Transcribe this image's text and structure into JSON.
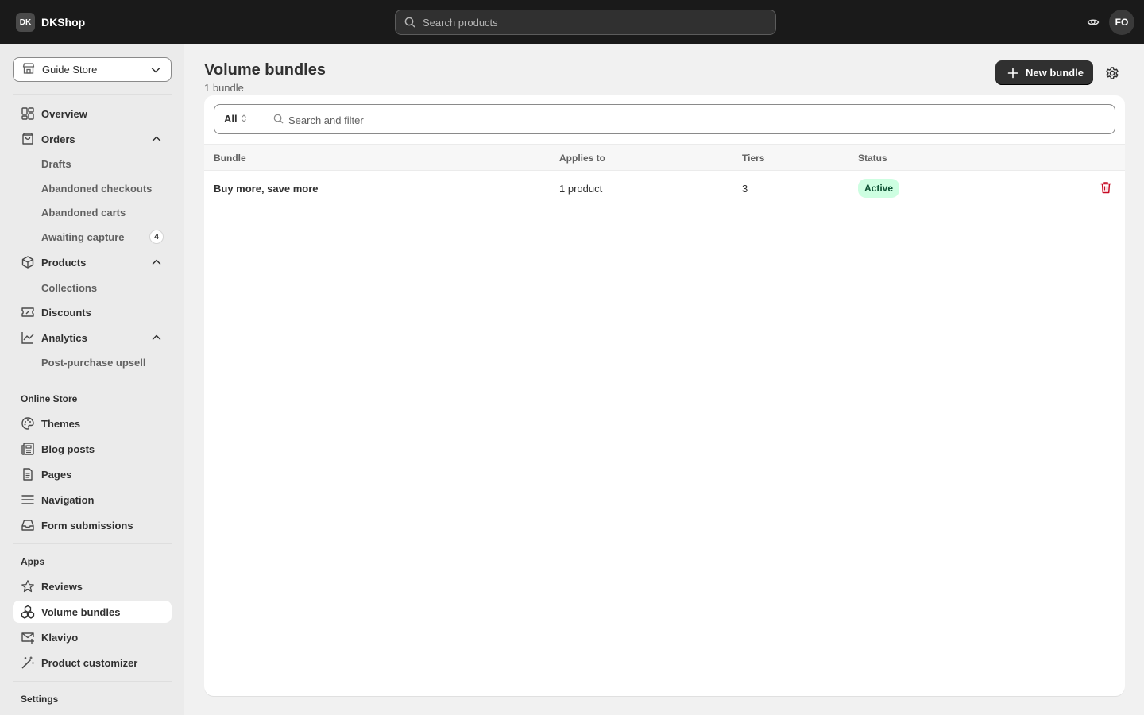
{
  "topbar": {
    "brand_logo": "DK",
    "brand_name": "DKShop",
    "search_placeholder": "Search products",
    "avatar_initials": "FO"
  },
  "sidebar": {
    "store": "Guide Store",
    "items": {
      "overview": "Overview",
      "orders": "Orders",
      "drafts": "Drafts",
      "abandoned_checkouts": "Abandoned checkouts",
      "abandoned_carts": "Abandoned carts",
      "awaiting_capture": "Awaiting capture",
      "awaiting_capture_count": "4",
      "products": "Products",
      "collections": "Collections",
      "discounts": "Discounts",
      "analytics": "Analytics",
      "post_purchase_upsell": "Post-purchase upsell"
    },
    "online_store_title": "Online Store",
    "online_store": {
      "themes": "Themes",
      "blog_posts": "Blog posts",
      "pages": "Pages",
      "navigation": "Navigation",
      "form_submissions": "Form submissions"
    },
    "apps_title": "Apps",
    "apps": {
      "reviews": "Reviews",
      "volume_bundles": "Volume bundles",
      "klaviyo": "Klaviyo",
      "product_customizer": "Product customizer"
    },
    "settings_title": "Settings"
  },
  "page": {
    "title": "Volume bundles",
    "subtitle": "1 bundle",
    "new_button": "New bundle",
    "filter_all": "All",
    "filter_placeholder": "Search and filter"
  },
  "table": {
    "headers": [
      "Bundle",
      "Applies to",
      "Tiers",
      "Status"
    ],
    "rows": [
      {
        "bundle": "Buy more, save more",
        "applies_to": "1 product",
        "tiers": "3",
        "status": "Active"
      }
    ]
  },
  "colors": {
    "topbar": "#1a1a1a",
    "sidebar": "#ebebeb",
    "primary_button": "#303030",
    "status_active_bg": "#cdfee1",
    "status_active_text": "#0c5132",
    "delete": "#c70a24"
  },
  "icons": {
    "search": "search-icon",
    "eye": "eye-icon",
    "store": "store-icon",
    "gear": "gear-icon",
    "trash": "trash-icon",
    "plus": "plus-icon"
  }
}
